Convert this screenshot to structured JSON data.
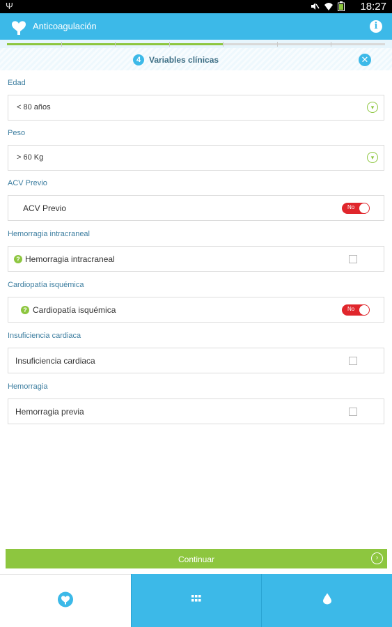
{
  "status_bar": {
    "time": "18:27"
  },
  "app_bar": {
    "title": "Anticoagulación",
    "info_glyph": "i"
  },
  "progress": {
    "segments": 7,
    "completed_fraction": 0.57
  },
  "step": {
    "number": "4",
    "title": "Variables clínicas",
    "close_glyph": "✕"
  },
  "form": {
    "edad": {
      "section_label": "Edad",
      "value": "< 80 años"
    },
    "peso": {
      "section_label": "Peso",
      "value": "> 60 Kg"
    },
    "acv": {
      "section_label": "ACV Previo",
      "label": "ACV Previo",
      "toggle_label": "No",
      "toggle_on": false
    },
    "hemorragia_intracraneal": {
      "section_label": "Hemorragia intracraneal",
      "label": "Hemorragia intracraneal",
      "checked": false
    },
    "cardiopatia": {
      "section_label": "Cardiopatía isquémica",
      "label": "Cardiopatía isquémica",
      "toggle_label": "No",
      "toggle_on": false
    },
    "insuficiencia": {
      "section_label": "Insuficiencia cardiaca",
      "label": "Insuficiencia cardiaca",
      "checked": false
    },
    "hemorragia": {
      "section_label": "Hemorragia",
      "label": "Hemorragia previa",
      "checked": false
    }
  },
  "continue_button": {
    "label": "Continuar"
  },
  "bottom_nav": {
    "tabs": [
      {
        "icon": "heart-icon",
        "active": true
      },
      {
        "icon": "grid-icon",
        "active": false
      },
      {
        "icon": "drop-icon",
        "active": false
      }
    ]
  },
  "colors": {
    "primary": "#3cb9e8",
    "accent_green": "#8dc63f",
    "toggle_red": "#e0262c",
    "label_blue": "#3d7ea0"
  }
}
